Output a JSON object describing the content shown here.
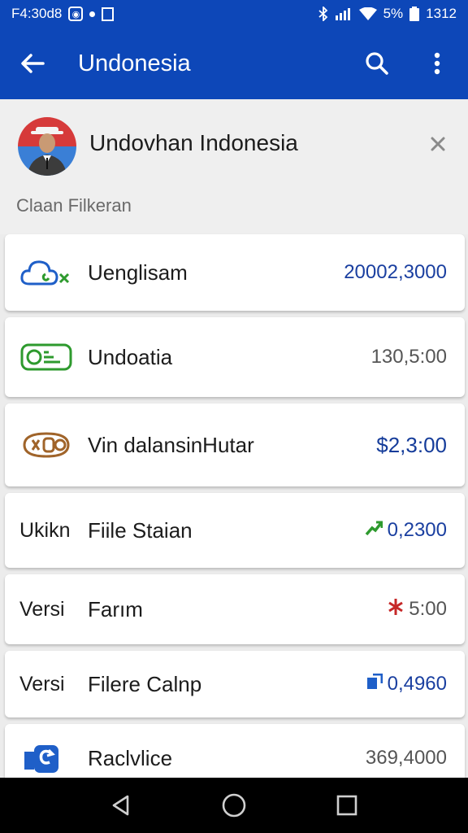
{
  "status_bar": {
    "time": "F4:30d8",
    "battery_percent": "5%",
    "clock_right": "1312",
    "icons": [
      "app-notification-icon",
      "dot-icon",
      "flag-icon",
      "bluetooth-icon",
      "signal-icon",
      "wifi-icon",
      "battery-icon"
    ]
  },
  "app_bar": {
    "title": "Undonesia",
    "icons": [
      "back-arrow-icon",
      "search-icon",
      "more-vert-icon"
    ]
  },
  "header": {
    "name": "Undovhan Indonesia",
    "subtitle": "Claan Filkeran",
    "icons": [
      "avatar",
      "close-icon"
    ]
  },
  "rows": [
    {
      "icon": "cloud-icon",
      "prefix": "",
      "label": "Uenglisam",
      "value": "20002,3000",
      "value_icon": ""
    },
    {
      "icon": "banknote-icon",
      "prefix": "",
      "label": "Undoatia",
      "value": "130,5:00",
      "value_icon": ""
    },
    {
      "icon": "coin-icon",
      "prefix": "",
      "label": "Vin dalansinHutar",
      "value": "$2,3:00",
      "value_icon": ""
    },
    {
      "icon": "",
      "prefix": "Ukikn",
      "label": "Fiile Staian",
      "value": "0,2300",
      "value_icon": "trend-up-icon"
    },
    {
      "icon": "",
      "prefix": "Versi",
      "label": "Farım",
      "value": "5:00",
      "value_icon": "asterisk-icon"
    },
    {
      "icon": "",
      "prefix": "Versi",
      "label": "Filere Calnp",
      "value": "0,4960",
      "value_icon": "chart-box-icon"
    },
    {
      "icon": "refresh-box-icon",
      "prefix": "",
      "label": "Raclvlice",
      "value": "369,4000",
      "value_icon": ""
    }
  ],
  "nav_bar": {
    "icons": [
      "nav-back-icon",
      "nav-home-icon",
      "nav-recents-icon"
    ]
  },
  "colors": {
    "primary": "#0d47b8",
    "background": "#ececec",
    "value_blue": "#1a3fa0",
    "value_gray": "#555555",
    "trend_green": "#2e9a2e",
    "asterisk_red": "#c62828"
  }
}
